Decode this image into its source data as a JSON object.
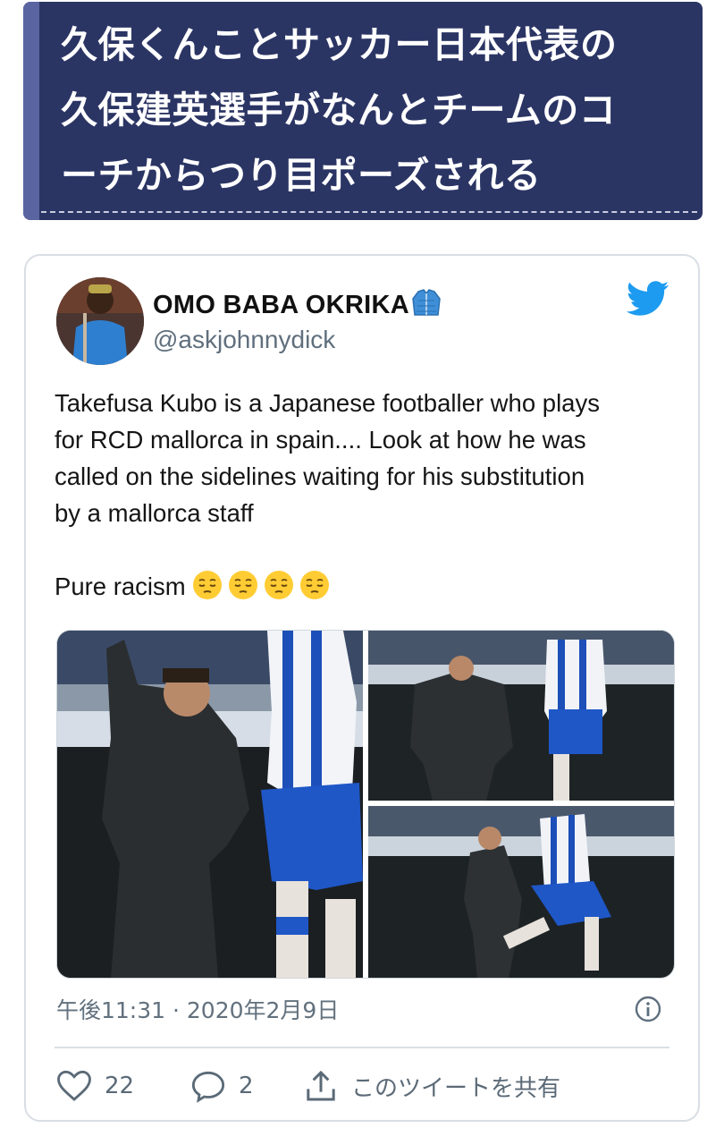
{
  "article": {
    "title_lines": [
      "久保くんことサッカー日本代表の",
      "久保建英選手がなんとチームのコ",
      "ーチからつり目ポーズされる"
    ]
  },
  "tweet": {
    "display_name": "OMO BABA OKRIKA",
    "handle": "@askjohnnydick",
    "text_lines": [
      "Takefusa Kubo is a Japanese footballer who plays",
      "for RCD mallorca in spain.... Look at how he was",
      "called on the sidelines waiting for his substitution",
      "by a mallorca staff"
    ],
    "closing_text": "Pure racism",
    "closing_emoji_count": 4,
    "timestamp": "午後11:31 · 2020年2月9日",
    "likes": "22",
    "replies": "2",
    "share_label": "このツイートを共有"
  },
  "colors": {
    "banner_bg": "#2b3564",
    "twitter_blue": "#1d9bf0",
    "muted_text": "#5b6a77"
  },
  "icons": [
    "twitter-bird-icon",
    "jacket-emoji-icon",
    "pensive-face-emoji-icon",
    "info-icon",
    "heart-icon",
    "reply-bubble-icon",
    "share-icon"
  ]
}
